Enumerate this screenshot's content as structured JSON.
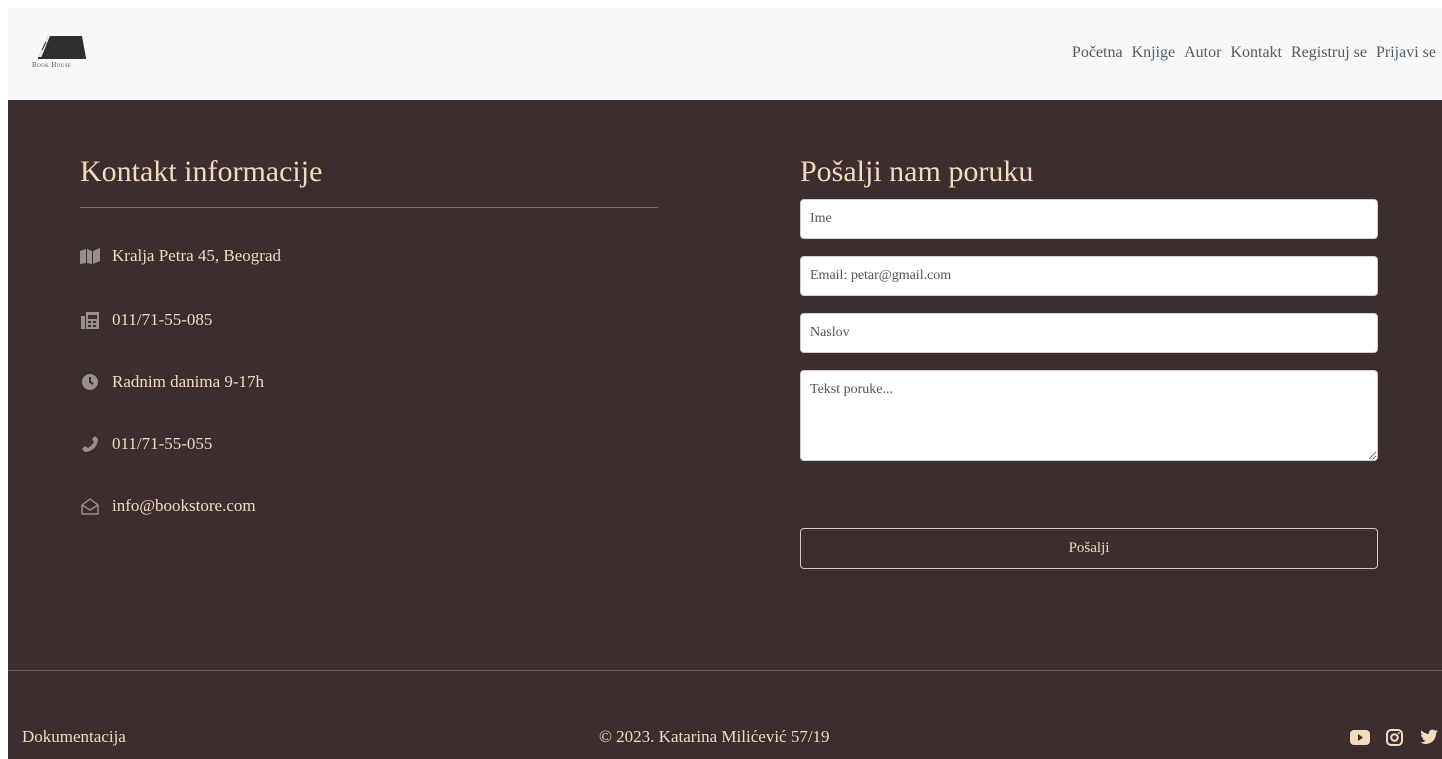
{
  "header": {
    "logo_text": "Book House",
    "nav": [
      "Početna",
      "Knjige",
      "Autor",
      "Kontakt",
      "Registruj se",
      "Prijavi se"
    ]
  },
  "contact": {
    "title": "Kontakt informacije",
    "items": [
      {
        "icon": "map-icon",
        "text": "Kralja Petra 45, Beograd"
      },
      {
        "icon": "fax-icon",
        "text": "011/71-55-085"
      },
      {
        "icon": "clock-icon",
        "text": "Radnim danima 9-17h"
      },
      {
        "icon": "phone-icon",
        "text": "011/71-55-055"
      },
      {
        "icon": "envelope-open-icon",
        "text": "info@bookstore.com"
      }
    ]
  },
  "form": {
    "title": "Pošalji nam poruku",
    "name_placeholder": "Ime",
    "email_placeholder": "Email: petar@gmail.com",
    "subject_placeholder": "Naslov",
    "message_placeholder": "Tekst poruke...",
    "submit_label": "Pošalji"
  },
  "footer": {
    "doc_link": "Dokumentacija",
    "copyright": "© 2023. Katarina Milićević 57/19",
    "social": [
      "youtube-icon",
      "instagram-icon",
      "twitter-icon"
    ]
  },
  "colors": {
    "background_dark": "#3c2e2e",
    "accent_text": "#f4dbbe",
    "header_bg": "#f7f8f9"
  }
}
